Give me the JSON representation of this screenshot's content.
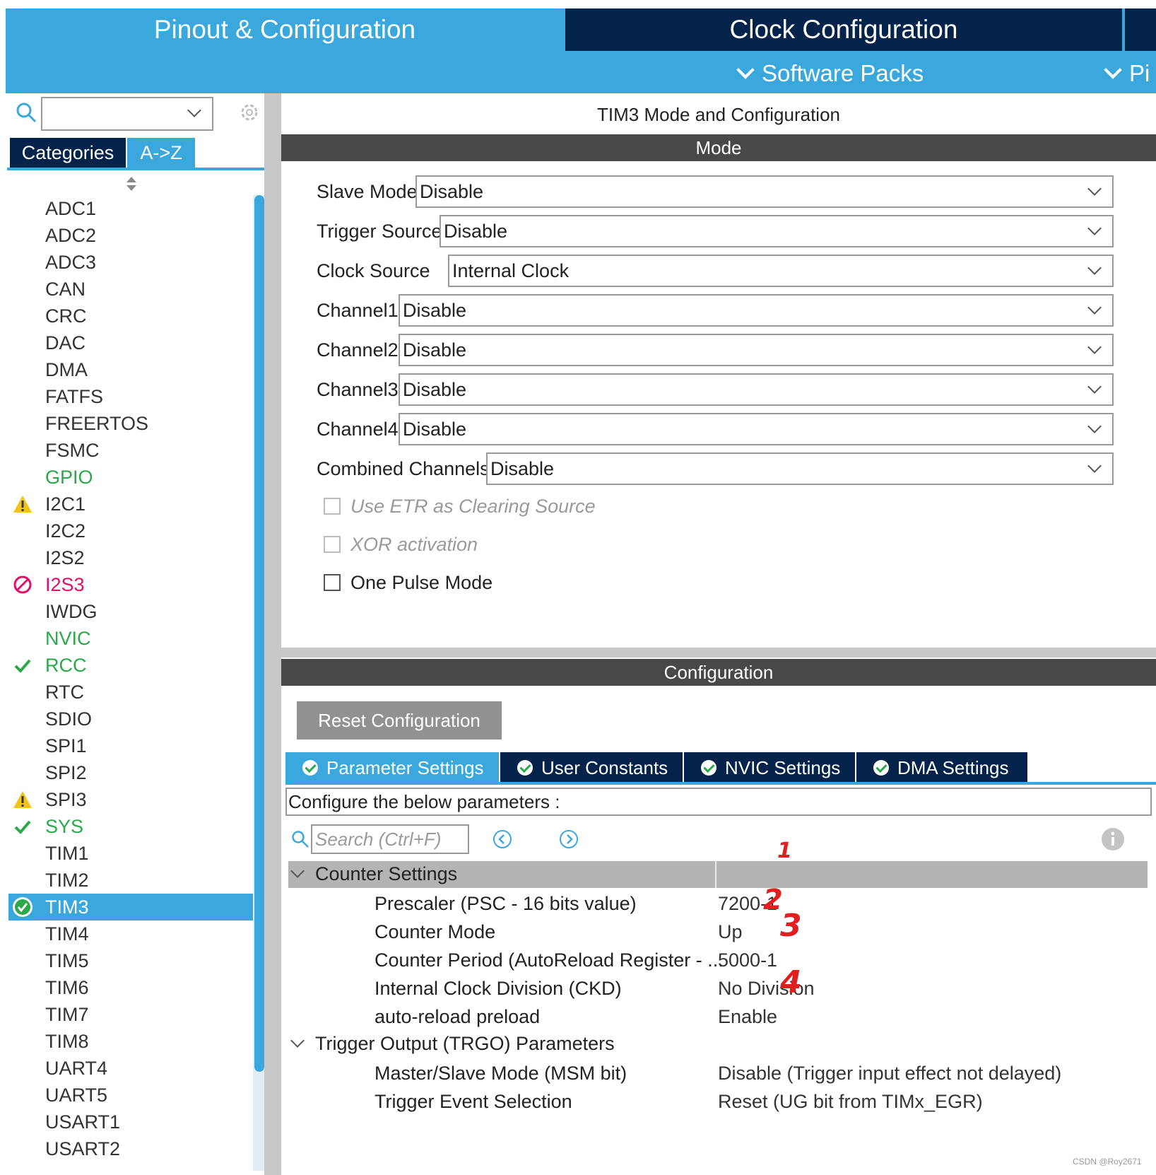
{
  "top_tabs": {
    "pinout": "Pinout & Configuration",
    "clock": "Clock Configuration"
  },
  "sub_tabs": {
    "software_packs": "Software Packs",
    "pinout_truncated": "Pi"
  },
  "left_panel": {
    "search_value": "",
    "tabs": {
      "categories": "Categories",
      "az": "A->Z"
    },
    "items": [
      {
        "label": "ADC1",
        "status": "none",
        "color": "#333333"
      },
      {
        "label": "ADC2",
        "status": "none",
        "color": "#333333"
      },
      {
        "label": "ADC3",
        "status": "none",
        "color": "#333333"
      },
      {
        "label": "CAN",
        "status": "none",
        "color": "#333333"
      },
      {
        "label": "CRC",
        "status": "none",
        "color": "#333333"
      },
      {
        "label": "DAC",
        "status": "none",
        "color": "#333333"
      },
      {
        "label": "DMA",
        "status": "none",
        "color": "#333333"
      },
      {
        "label": "FATFS",
        "status": "none",
        "color": "#333333"
      },
      {
        "label": "FREERTOS",
        "status": "none",
        "color": "#333333"
      },
      {
        "label": "FSMC",
        "status": "none",
        "color": "#333333"
      },
      {
        "label": "GPIO",
        "status": "none",
        "color": "#2aa84a"
      },
      {
        "label": "I2C1",
        "status": "warning-icon",
        "color": "#333333"
      },
      {
        "label": "I2C2",
        "status": "none",
        "color": "#333333"
      },
      {
        "label": "I2S2",
        "status": "none",
        "color": "#333333"
      },
      {
        "label": "I2S3",
        "status": "blocked-icon",
        "color": "#e0116b"
      },
      {
        "label": "IWDG",
        "status": "none",
        "color": "#333333"
      },
      {
        "label": "NVIC",
        "status": "none",
        "color": "#2aa84a"
      },
      {
        "label": "RCC",
        "status": "check-icon",
        "color": "#2aa84a"
      },
      {
        "label": "RTC",
        "status": "none",
        "color": "#333333"
      },
      {
        "label": "SDIO",
        "status": "none",
        "color": "#333333"
      },
      {
        "label": "SPI1",
        "status": "none",
        "color": "#333333"
      },
      {
        "label": "SPI2",
        "status": "none",
        "color": "#333333"
      },
      {
        "label": "SPI3",
        "status": "warning-icon",
        "color": "#333333"
      },
      {
        "label": "SYS",
        "status": "check-icon",
        "color": "#2aa84a"
      },
      {
        "label": "TIM1",
        "status": "none",
        "color": "#333333"
      },
      {
        "label": "TIM2",
        "status": "none",
        "color": "#333333"
      },
      {
        "label": "TIM3",
        "status": "selected-check-icon",
        "color": "#ffffff",
        "selected": true
      },
      {
        "label": "TIM4",
        "status": "none",
        "color": "#333333"
      },
      {
        "label": "TIM5",
        "status": "none",
        "color": "#333333"
      },
      {
        "label": "TIM6",
        "status": "none",
        "color": "#333333"
      },
      {
        "label": "TIM7",
        "status": "none",
        "color": "#333333"
      },
      {
        "label": "TIM8",
        "status": "none",
        "color": "#333333"
      },
      {
        "label": "UART4",
        "status": "none",
        "color": "#333333"
      },
      {
        "label": "UART5",
        "status": "none",
        "color": "#333333"
      },
      {
        "label": "USART1",
        "status": "none",
        "color": "#333333"
      },
      {
        "label": "USART2",
        "status": "none",
        "color": "#333333"
      }
    ]
  },
  "main": {
    "title": "TIM3 Mode and Configuration",
    "mode_header": "Mode",
    "mode_fields": [
      {
        "label": "Slave Mode",
        "value": "Disable"
      },
      {
        "label": "Trigger Source",
        "value": "Disable"
      },
      {
        "label": "Clock Source",
        "value": "Internal Clock"
      },
      {
        "label": "Channel1",
        "value": "Disable"
      },
      {
        "label": "Channel2",
        "value": "Disable"
      },
      {
        "label": "Channel3",
        "value": "Disable"
      },
      {
        "label": "Channel4",
        "value": "Disable"
      },
      {
        "label": "Combined Channels",
        "value": "Disable"
      }
    ],
    "checkboxes": [
      {
        "label": "Use ETR as Clearing Source",
        "disabled": true,
        "checked": false
      },
      {
        "label": "XOR activation",
        "disabled": true,
        "checked": false
      },
      {
        "label": "One Pulse Mode",
        "disabled": false,
        "checked": false
      }
    ],
    "config_header": "Configuration",
    "reset_button": "Reset Configuration",
    "param_tabs": [
      {
        "label": "Parameter Settings",
        "active": true
      },
      {
        "label": "User Constants",
        "active": false
      },
      {
        "label": "NVIC Settings",
        "active": false
      },
      {
        "label": "DMA Settings",
        "active": false
      }
    ],
    "configure_text": "Configure the below parameters :",
    "search_placeholder": "Search (Ctrl+F)",
    "groups": [
      {
        "name": "Counter Settings",
        "rows": [
          {
            "name": "Prescaler (PSC - 16 bits value)",
            "value": "7200-1"
          },
          {
            "name": "Counter Mode",
            "value": "Up"
          },
          {
            "name": "Counter Period (AutoReload Register - ...",
            "value": "5000-1"
          },
          {
            "name": "Internal Clock Division (CKD)",
            "value": "No Division"
          },
          {
            "name": "auto-reload preload",
            "value": "Enable"
          }
        ]
      },
      {
        "name": "Trigger Output (TRGO) Parameters",
        "rows": [
          {
            "name": "Master/Slave Mode (MSM bit)",
            "value": "Disable (Trigger input effect not delayed)"
          },
          {
            "name": "Trigger Event Selection",
            "value": "Reset (UG bit from TIMx_EGR)"
          }
        ]
      }
    ],
    "annotations": [
      "1",
      "2",
      "3",
      "4"
    ]
  },
  "watermark": "CSDN @Roy2671",
  "colors": {
    "accent_blue": "#3aa8dc",
    "navy": "#03234b",
    "band_dark": "#484848",
    "annotation_red": "#e02020"
  }
}
